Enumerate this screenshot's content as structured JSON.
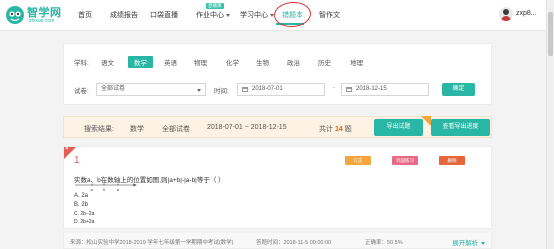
{
  "brand": {
    "name": "智学网",
    "domain": "zhixue.com",
    "color": "#2ab6a4"
  },
  "nav": {
    "items": [
      {
        "label": "首页"
      },
      {
        "label": "成绩报告"
      },
      {
        "label": "口袋直播"
      },
      {
        "label": "作业中心"
      },
      {
        "label": "学习中心"
      },
      {
        "label": "错题本"
      },
      {
        "label": "智作文"
      }
    ],
    "live_badge": "直播课",
    "active": "错题本"
  },
  "user": {
    "name": "zxp8..."
  },
  "filter": {
    "subject_label": "学科:",
    "subjects": [
      "语文",
      "数学",
      "英语",
      "物理",
      "化学",
      "生物",
      "政治",
      "历史",
      "地理"
    ],
    "active_subject": "数学",
    "exam_label": "试卷:",
    "exam_value": "全部试卷",
    "time_label": "时间:",
    "date_from": "2018-07-01",
    "date_sep": "-",
    "date_to": "2018-12-15",
    "confirm_label": "确定"
  },
  "results": {
    "label": "搜索结果:",
    "subject": "数学",
    "exam": "全部试卷",
    "range": "2018-07-01 ~ 2018-12-15",
    "total_prefix": "共计",
    "count": "14",
    "total_suffix": "题",
    "export_label": "导出试题",
    "progress_label": "查看导出进度"
  },
  "question": {
    "number": "1",
    "tags": [
      {
        "label": "订正",
        "color": "#f3a63b"
      },
      {
        "label": "巩固练习",
        "color": "#e96a85"
      },
      {
        "label": "删除",
        "color": "#e5673c"
      }
    ],
    "stem": "实数a、b在数轴上的位置如图,则|a+b|-|a-b|等于（  ）",
    "number_line": {
      "a": "a",
      "zero": "0",
      "b": "b"
    },
    "options": [
      {
        "label": "A. 2a"
      },
      {
        "label": "B. 2b"
      },
      {
        "label": "C. 2b−2a"
      },
      {
        "label": "D. 2b+2a"
      }
    ]
  },
  "footer": {
    "source": "来源：松山实验中学2018-2019 学年七年级第一学期期中考试(数学)",
    "time": "答题时间：2018-11-5 00:00:00",
    "accuracy": "正确率：50.5%",
    "expand_label": "展开解析"
  }
}
